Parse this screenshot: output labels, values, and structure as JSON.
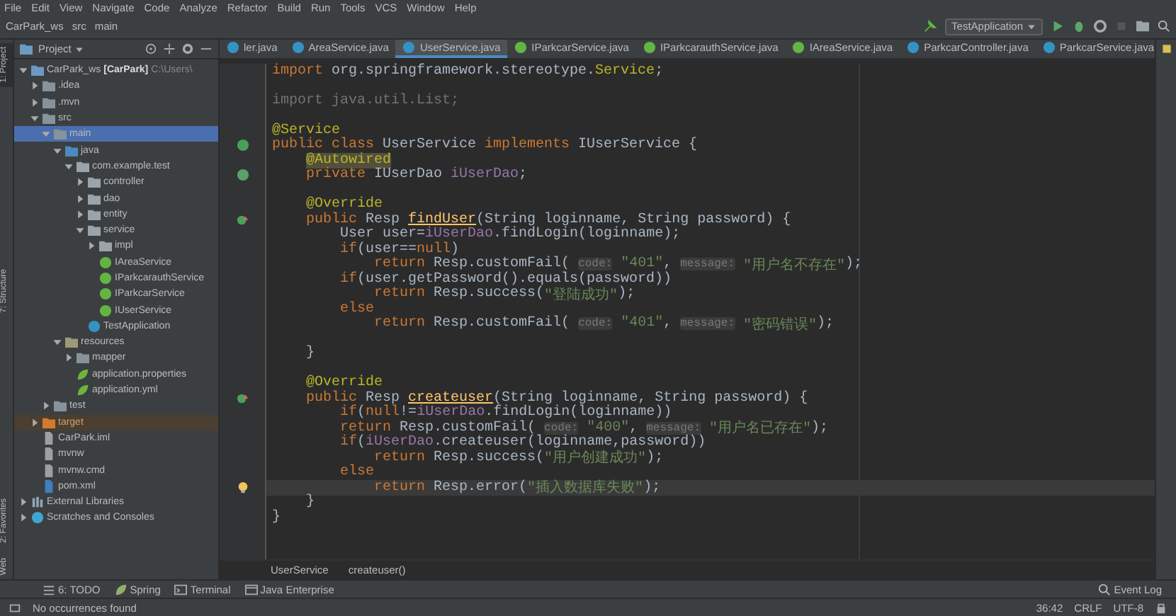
{
  "menu": [
    "File",
    "Edit",
    "View",
    "Navigate",
    "Code",
    "Analyze",
    "Refactor",
    "Build",
    "Run",
    "Tools",
    "VCS",
    "Window",
    "Help"
  ],
  "breadcrumb_nav": [
    "CarPark_ws",
    "src",
    "main"
  ],
  "run_config": {
    "label": "TestApplication"
  },
  "side_tabs_left": [
    {
      "label": "1: Project",
      "selected": true
    },
    {
      "label": "7: Structure",
      "selected": false
    },
    {
      "label": "2: Favorites",
      "selected": false
    },
    {
      "label": "Web",
      "selected": false
    }
  ],
  "project_panel": {
    "title": "Project"
  },
  "tree": [
    {
      "name": "CarPark_ws",
      "module": "[CarPark]",
      "path": "C:\\Users\\",
      "kind": "module",
      "expanded": true,
      "selected": false,
      "children": [
        {
          "name": ".idea",
          "kind": "folder",
          "expanded": false,
          "selected": false
        },
        {
          "name": ".mvn",
          "kind": "folder",
          "expanded": false,
          "selected": false
        },
        {
          "name": "src",
          "kind": "folder",
          "expanded": true,
          "selected": false,
          "children": [
            {
              "name": "main",
              "kind": "folder",
              "expanded": true,
              "selected": true,
              "children": [
                {
                  "name": "java",
                  "kind": "source-folder",
                  "expanded": true,
                  "selected": false,
                  "children": [
                    {
                      "name": "com.example.test",
                      "kind": "package",
                      "expanded": true,
                      "selected": false,
                      "children": [
                        {
                          "name": "controller",
                          "kind": "package",
                          "expanded": false,
                          "selected": false
                        },
                        {
                          "name": "dao",
                          "kind": "package",
                          "expanded": false,
                          "selected": false
                        },
                        {
                          "name": "entity",
                          "kind": "package",
                          "expanded": false,
                          "selected": false
                        },
                        {
                          "name": "service",
                          "kind": "package",
                          "expanded": true,
                          "selected": false,
                          "children": [
                            {
                              "name": "impl",
                              "kind": "package",
                              "expanded": false,
                              "selected": false
                            },
                            {
                              "name": "IAreaService",
                              "kind": "interface",
                              "selected": false
                            },
                            {
                              "name": "IParkcarauthService",
                              "kind": "interface",
                              "selected": false
                            },
                            {
                              "name": "IParkcarService",
                              "kind": "interface",
                              "selected": false
                            },
                            {
                              "name": "IUserService",
                              "kind": "interface",
                              "selected": false
                            }
                          ]
                        },
                        {
                          "name": "TestApplication",
                          "kind": "spring-class",
                          "selected": false
                        }
                      ]
                    }
                  ]
                },
                {
                  "name": "resources",
                  "kind": "resource-folder",
                  "expanded": true,
                  "selected": false,
                  "children": [
                    {
                      "name": "mapper",
                      "kind": "folder",
                      "expanded": false,
                      "selected": false
                    },
                    {
                      "name": "application.properties",
                      "kind": "config",
                      "selected": false
                    },
                    {
                      "name": "application.yml",
                      "kind": "config",
                      "selected": false
                    }
                  ]
                }
              ]
            },
            {
              "name": "test",
              "kind": "folder",
              "expanded": false,
              "selected": false
            }
          ]
        },
        {
          "name": "target",
          "kind": "excluded-folder",
          "expanded": false,
          "selected": false
        },
        {
          "name": "CarPark.iml",
          "kind": "file",
          "selected": false
        },
        {
          "name": "mvnw",
          "kind": "file",
          "selected": false
        },
        {
          "name": "mvnw.cmd",
          "kind": "file",
          "selected": false
        },
        {
          "name": "pom.xml",
          "kind": "maven",
          "selected": false
        }
      ]
    },
    {
      "name": "External Libraries",
      "kind": "library",
      "expanded": false,
      "selected": false
    },
    {
      "name": "Scratches and Consoles",
      "kind": "scratch",
      "expanded": false,
      "selected": false
    }
  ],
  "tabs": [
    {
      "label": "ler.java",
      "kind": "class",
      "selected": false
    },
    {
      "label": "AreaService.java",
      "kind": "class",
      "selected": false
    },
    {
      "label": "UserService.java",
      "kind": "class",
      "selected": true
    },
    {
      "label": "IParkcarService.java",
      "kind": "interface",
      "selected": false
    },
    {
      "label": "IParkcarauthService.java",
      "kind": "interface",
      "selected": false
    },
    {
      "label": "IAreaService.java",
      "kind": "interface",
      "selected": false
    },
    {
      "label": "ParkcarController.java",
      "kind": "class",
      "selected": false
    },
    {
      "label": "ParkcarService.java",
      "kind": "class",
      "selected": false
    }
  ],
  "code": {
    "lines": [
      {
        "kind": "code",
        "current": false,
        "tokens": [
          {
            "kind": "kw",
            "text": "import "
          },
          {
            "kind": "plain",
            "text": "org.springframework.stereotype."
          },
          {
            "kind": "ann",
            "text": "Service"
          },
          {
            "kind": "plain",
            "text": ";"
          }
        ]
      },
      {
        "kind": "blank"
      },
      {
        "kind": "code",
        "current": false,
        "tokens": [
          {
            "kind": "dim",
            "text": "import java.util.List;"
          }
        ]
      },
      {
        "kind": "blank"
      },
      {
        "kind": "code",
        "current": false,
        "tokens": [
          {
            "kind": "ann",
            "text": "@Service"
          }
        ]
      },
      {
        "kind": "marked-implements",
        "current": false,
        "tokens": [
          {
            "kind": "kw",
            "text": "public class "
          },
          {
            "kind": "plain",
            "text": "UserService "
          },
          {
            "kind": "kw",
            "text": "implements "
          },
          {
            "kind": "plain",
            "text": "IUserService {"
          }
        ]
      },
      {
        "kind": "code",
        "current": false,
        "tokens": [
          {
            "kind": "warn",
            "text": "    @Autowired"
          }
        ]
      },
      {
        "kind": "marked-bean",
        "current": false,
        "tokens": [
          {
            "kind": "kw",
            "text": "    private "
          },
          {
            "kind": "plain",
            "text": "IUserDao "
          },
          {
            "kind": "field",
            "text": "iUserDao"
          },
          {
            "kind": "plain",
            "text": ";"
          }
        ]
      },
      {
        "kind": "blank"
      },
      {
        "kind": "code",
        "current": false,
        "tokens": [
          {
            "kind": "ann",
            "text": "    @Override"
          }
        ]
      },
      {
        "kind": "marked-override",
        "current": false,
        "tokens": [
          {
            "kind": "kw",
            "text": "    public "
          },
          {
            "kind": "plain",
            "text": "Resp "
          },
          {
            "kind": "method",
            "text": "findUser"
          },
          {
            "kind": "plain",
            "text": "(String loginname, String password) {"
          }
        ]
      },
      {
        "kind": "code",
        "current": false,
        "tokens": [
          {
            "kind": "plain",
            "text": "        User user="
          },
          {
            "kind": "field",
            "text": "iUserDao"
          },
          {
            "kind": "plain",
            "text": ".findLogin(loginname);"
          }
        ]
      },
      {
        "kind": "code",
        "current": false,
        "tokens": [
          {
            "kind": "kw",
            "text": "        if"
          },
          {
            "kind": "plain",
            "text": "(user=="
          },
          {
            "kind": "kw",
            "text": "null"
          },
          {
            "kind": "plain",
            "text": ")"
          }
        ]
      },
      {
        "kind": "code",
        "current": false,
        "tokens": [
          {
            "kind": "kw",
            "text": "            return "
          },
          {
            "kind": "plain",
            "text": "Resp.customFail( "
          },
          {
            "kind": "hint",
            "text": "code:"
          },
          {
            "kind": "str",
            "text": " \"401\""
          },
          {
            "kind": "plain",
            "text": ", "
          },
          {
            "kind": "hint",
            "text": "message:"
          },
          {
            "kind": "str",
            "text": " \"用户名不存在\""
          },
          {
            "kind": "plain",
            "text": ");"
          }
        ]
      },
      {
        "kind": "code",
        "current": false,
        "tokens": [
          {
            "kind": "kw",
            "text": "        if"
          },
          {
            "kind": "plain",
            "text": "(user.getPassword().equals(password))"
          }
        ]
      },
      {
        "kind": "code",
        "current": false,
        "tokens": [
          {
            "kind": "kw",
            "text": "            return "
          },
          {
            "kind": "plain",
            "text": "Resp.success("
          },
          {
            "kind": "str",
            "text": "\"登陆成功\""
          },
          {
            "kind": "plain",
            "text": ");"
          }
        ]
      },
      {
        "kind": "code",
        "current": false,
        "tokens": [
          {
            "kind": "kw",
            "text": "        else"
          }
        ]
      },
      {
        "kind": "code",
        "current": false,
        "tokens": [
          {
            "kind": "kw",
            "text": "            return "
          },
          {
            "kind": "plain",
            "text": "Resp.customFail( "
          },
          {
            "kind": "hint",
            "text": "code:"
          },
          {
            "kind": "str",
            "text": " \"401\""
          },
          {
            "kind": "plain",
            "text": ", "
          },
          {
            "kind": "hint",
            "text": "message:"
          },
          {
            "kind": "str",
            "text": " \"密码错误\""
          },
          {
            "kind": "plain",
            "text": ");"
          }
        ]
      },
      {
        "kind": "blank"
      },
      {
        "kind": "code",
        "current": false,
        "tokens": [
          {
            "kind": "plain",
            "text": "    }"
          }
        ]
      },
      {
        "kind": "blank"
      },
      {
        "kind": "code",
        "current": false,
        "tokens": [
          {
            "kind": "ann",
            "text": "    @Override"
          }
        ]
      },
      {
        "kind": "marked-override",
        "current": false,
        "tokens": [
          {
            "kind": "kw",
            "text": "    public "
          },
          {
            "kind": "plain",
            "text": "Resp "
          },
          {
            "kind": "method",
            "text": "createuser"
          },
          {
            "kind": "plain",
            "text": "(String loginname, String password) {"
          }
        ]
      },
      {
        "kind": "code",
        "current": false,
        "tokens": [
          {
            "kind": "kw",
            "text": "        if"
          },
          {
            "kind": "plain",
            "text": "("
          },
          {
            "kind": "kw",
            "text": "null"
          },
          {
            "kind": "plain",
            "text": "!="
          },
          {
            "kind": "field",
            "text": "iUserDao"
          },
          {
            "kind": "plain",
            "text": ".findLogin(loginname))"
          }
        ]
      },
      {
        "kind": "code",
        "current": false,
        "tokens": [
          {
            "kind": "kw",
            "text": "        return "
          },
          {
            "kind": "plain",
            "text": "Resp.customFail( "
          },
          {
            "kind": "hint",
            "text": "code:"
          },
          {
            "kind": "str",
            "text": " \"400\""
          },
          {
            "kind": "plain",
            "text": ", "
          },
          {
            "kind": "hint",
            "text": "message:"
          },
          {
            "kind": "str",
            "text": " \"用户名已存在\""
          },
          {
            "kind": "plain",
            "text": ");"
          }
        ]
      },
      {
        "kind": "code",
        "current": false,
        "tokens": [
          {
            "kind": "kw",
            "text": "        if"
          },
          {
            "kind": "plain",
            "text": "("
          },
          {
            "kind": "field",
            "text": "iUserDao"
          },
          {
            "kind": "plain",
            "text": ".createuser(loginname,password))"
          }
        ]
      },
      {
        "kind": "code",
        "current": false,
        "tokens": [
          {
            "kind": "kw",
            "text": "            return "
          },
          {
            "kind": "plain",
            "text": "Resp.success("
          },
          {
            "kind": "str",
            "text": "\"用户创建成功\""
          },
          {
            "kind": "plain",
            "text": ");"
          }
        ]
      },
      {
        "kind": "code",
        "current": false,
        "tokens": [
          {
            "kind": "kw",
            "text": "        else"
          }
        ]
      },
      {
        "kind": "marked-bulb",
        "current": true,
        "tokens": [
          {
            "kind": "kw",
            "text": "            return "
          },
          {
            "kind": "plain",
            "text": "Resp.error("
          },
          {
            "kind": "str",
            "text": "\"插入数据库失败\""
          },
          {
            "kind": "plain",
            "text": ");"
          }
        ]
      },
      {
        "kind": "code",
        "current": false,
        "tokens": [
          {
            "kind": "plain",
            "text": "    }"
          }
        ]
      },
      {
        "kind": "code",
        "current": false,
        "tokens": [
          {
            "kind": "plain",
            "text": "}"
          }
        ]
      }
    ]
  },
  "editor_breadcrumb": [
    "UserService",
    "createuser()"
  ],
  "tool_windows": [
    {
      "label": "6: TODO",
      "kind": "todo"
    },
    {
      "label": "Spring",
      "kind": "spring"
    },
    {
      "label": "Terminal",
      "kind": "terminal"
    },
    {
      "label": "Java Enterprise",
      "kind": "enterprise"
    }
  ],
  "event_log": "Event Log",
  "status_bar": {
    "message": "No occurrences found",
    "position": "36:42",
    "line_separator": "CRLF",
    "encoding": "UTF-8"
  }
}
